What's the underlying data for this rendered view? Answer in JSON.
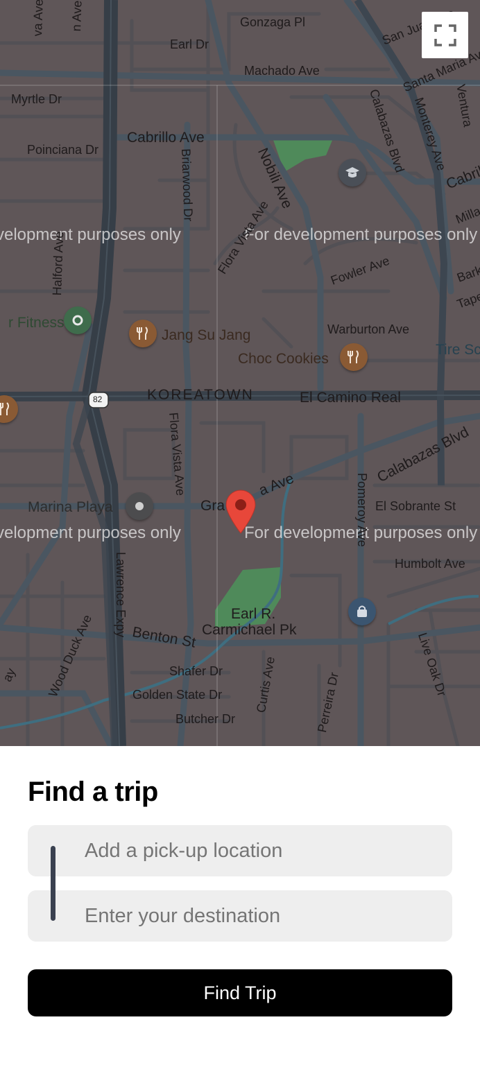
{
  "map": {
    "street_labels": [
      "Gonzaga Pl",
      "Earl Dr",
      "Machado Ave",
      "San Juan Ave",
      "Santa Maria Ave",
      "Myrtle Dr",
      "Calabazas Blvd",
      "Monterey Ave",
      "Ventura",
      "Cabrillo Ave",
      "Poinciana Dr",
      "Briarwood Dr",
      "Nobili Ave",
      "Cabril",
      "Milla",
      "Barkl",
      "Tape",
      "Halford Ave",
      "Flora Vista Ave",
      "Fowler Ave",
      "Warburton Ave",
      "KOREATOWN",
      "El Camino Real",
      "82",
      "Flora Vista Ave",
      "Calabazas Blvd",
      "Gra",
      "a Ave",
      "El Sobrante St",
      "Pomeroy Ave",
      "Humbolt Ave",
      "Lawrence Expy",
      "Benton St",
      "Wood Duck Ave",
      "Shafer Dr",
      "Curtis Ave",
      "Golden State Dr",
      "Perreira Dr",
      "Live Oak Dr",
      "Butcher Dr",
      "ay",
      "n Ave",
      "va Ave",
      "Earl R.",
      "Carmichael Pk"
    ],
    "places": [
      "r Fitness",
      "Jang Su Jang",
      "Choc Cookies",
      "Tire Sc",
      "Marina Playa"
    ],
    "watermark": [
      "velopment purposes only",
      "For development purposes only",
      "velopment purposes only",
      "For development purposes only"
    ],
    "pin_color": "#e8473a",
    "park_color": "#4f8a5a",
    "road_color": "#3f4a55",
    "water_color": "#3f6e80",
    "icons": [
      "fullscreen-icon",
      "location-pin-icon",
      "fitness-icon",
      "restaurant-icon",
      "school-icon",
      "shopping-icon",
      "place-icon"
    ]
  },
  "trip": {
    "title": "Find a trip",
    "pickup_placeholder": "Add a pick-up location",
    "destination_placeholder": "Enter your destination",
    "button_label": "Find Trip"
  }
}
